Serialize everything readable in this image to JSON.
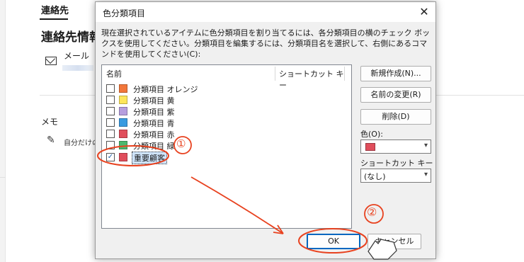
{
  "background": {
    "tab_label": "連絡先",
    "title": "連絡先情報",
    "mail_label": "メール",
    "memo_label": "メモ",
    "memo_text": "自分だけの"
  },
  "dialog": {
    "title": "色分類項目",
    "description": "現在選択されているアイテムに色分類項目を割り当てるには、各分類項目の横のチェック ボックスを使用してください。分類項目を編集するには、分類項目名を選択して、右側にあるコマンドを使用してください(C):",
    "list": {
      "col_name": "名前",
      "col_shortcut": "ショートカット キー",
      "items": [
        {
          "label": "分類項目 オレンジ",
          "color": "#f2773b",
          "checked": false
        },
        {
          "label": "分類項目 黄",
          "color": "#fde65b",
          "checked": false
        },
        {
          "label": "分類項目 紫",
          "color": "#b69ede",
          "checked": false
        },
        {
          "label": "分類項目 青",
          "color": "#3a9be0",
          "checked": false
        },
        {
          "label": "分類項目 赤",
          "color": "#e04e5c",
          "checked": false
        },
        {
          "label": "分類項目 緑",
          "color": "#4cb86e",
          "checked": false
        },
        {
          "label": "重要顧客",
          "color": "#e04e5c",
          "checked": true
        }
      ]
    },
    "buttons": {
      "new": "新規作成(N)...",
      "rename": "名前の変更(R)",
      "delete": "削除(D)",
      "ok": "OK",
      "cancel": "キャンセル"
    },
    "color_label": "色(O):",
    "color_value": "#e04e5c",
    "shortcut_label": "ショートカット キー(S):",
    "shortcut_value": "(なし)"
  },
  "annotations": {
    "step1": "①",
    "step2": "②",
    "accent_color": "#e8421f"
  }
}
